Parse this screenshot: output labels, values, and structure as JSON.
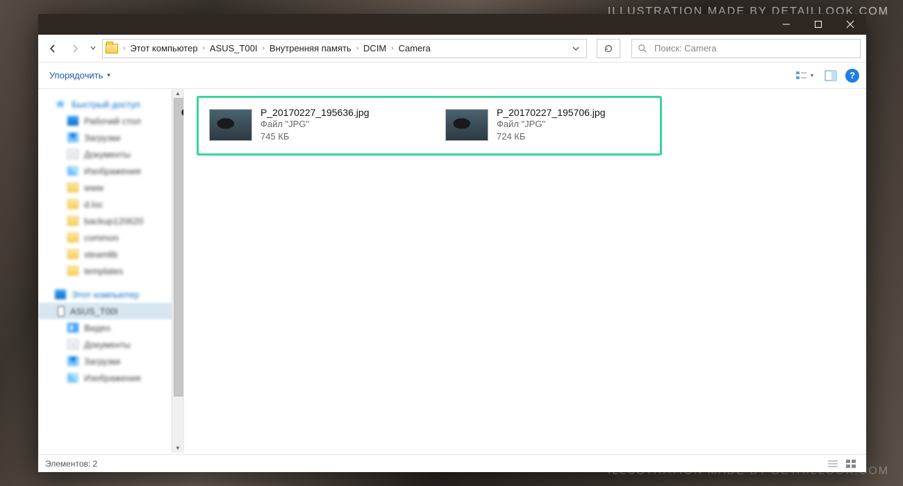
{
  "watermark_top": "ILLUSTRATION MADE BY DETAILLOOK.COM",
  "watermark_bottom": "ILLUSTRATION MADE BY DETAILLOOK.COM",
  "titlebar": {},
  "breadcrumb": {
    "segments": [
      "Этот компьютер",
      "ASUS_T00I",
      "Внутренняя память",
      "DCIM",
      "Camera"
    ]
  },
  "search": {
    "placeholder": "Поиск: Camera"
  },
  "toolbar": {
    "organize": "Упорядочить"
  },
  "sidebar": {
    "quick_access": "Быстрый доступ",
    "desktop": "Рабочий стол",
    "downloads": "Загрузки",
    "documents": "Документы",
    "pictures": "Изображения",
    "folders": [
      "www",
      "d.loc",
      "backup120620",
      "common",
      "steamlib",
      "templates"
    ],
    "this_pc": "Этот компьютер",
    "device": "ASUS_T00I",
    "video": "Видео",
    "documents2": "Документы",
    "downloads2": "Загрузки",
    "pictures2": "Изображения"
  },
  "files": [
    {
      "name": "P_20170227_195636.jpg",
      "type": "Файл \"JPG\"",
      "size": "745 КБ"
    },
    {
      "name": "P_20170227_195706.jpg",
      "type": "Файл \"JPG\"",
      "size": "724 КБ"
    }
  ],
  "status": {
    "count_label": "Элементов: 2"
  }
}
